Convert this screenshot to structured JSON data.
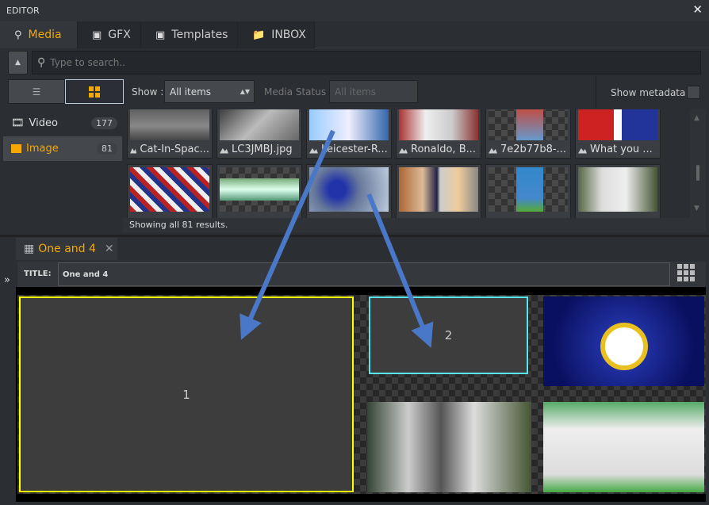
{
  "window": {
    "title": "EDITOR",
    "close": "✕"
  },
  "tabs": [
    {
      "label": "Media",
      "icon": "search-icon",
      "active": true
    },
    {
      "label": "GFX",
      "icon": "gfx-icon"
    },
    {
      "label": "Templates",
      "icon": "template-icon"
    },
    {
      "label": "INBOX",
      "icon": "folder-icon"
    }
  ],
  "search": {
    "placeholder": "Type to search.."
  },
  "toolbar": {
    "show_label": "Show :",
    "show_value": "All items",
    "status_label": "Media Status :",
    "status_value": "All items",
    "metadata_label": "Show metadata :",
    "metadata_checked": false,
    "view_mode": "grid"
  },
  "sidebar": {
    "items": [
      {
        "label": "Video",
        "count": "177",
        "icon": "video-icon"
      },
      {
        "label": "Image",
        "count": "81",
        "icon": "image-icon",
        "active": true
      }
    ]
  },
  "media": {
    "row1": [
      {
        "label": "Cat-In-Spac..."
      },
      {
        "label": "LC3JMBJ.jpg"
      },
      {
        "label": "Leicester-R..."
      },
      {
        "label": "Ronaldo, B..."
      },
      {
        "label": "7e2b77b8-..."
      },
      {
        "label": "What you ..."
      }
    ],
    "status": "Showing all 81 results."
  },
  "playlist": {
    "tab_label": "One and 4",
    "title_label": "TITLE:",
    "title_value": "One and 4",
    "cells": [
      {
        "label": "1",
        "border": "#ffff00"
      },
      {
        "label": "2",
        "border": "#55e6ee"
      }
    ]
  },
  "colors": {
    "accent": "#f5a800",
    "arrow": "#4a78c8"
  }
}
